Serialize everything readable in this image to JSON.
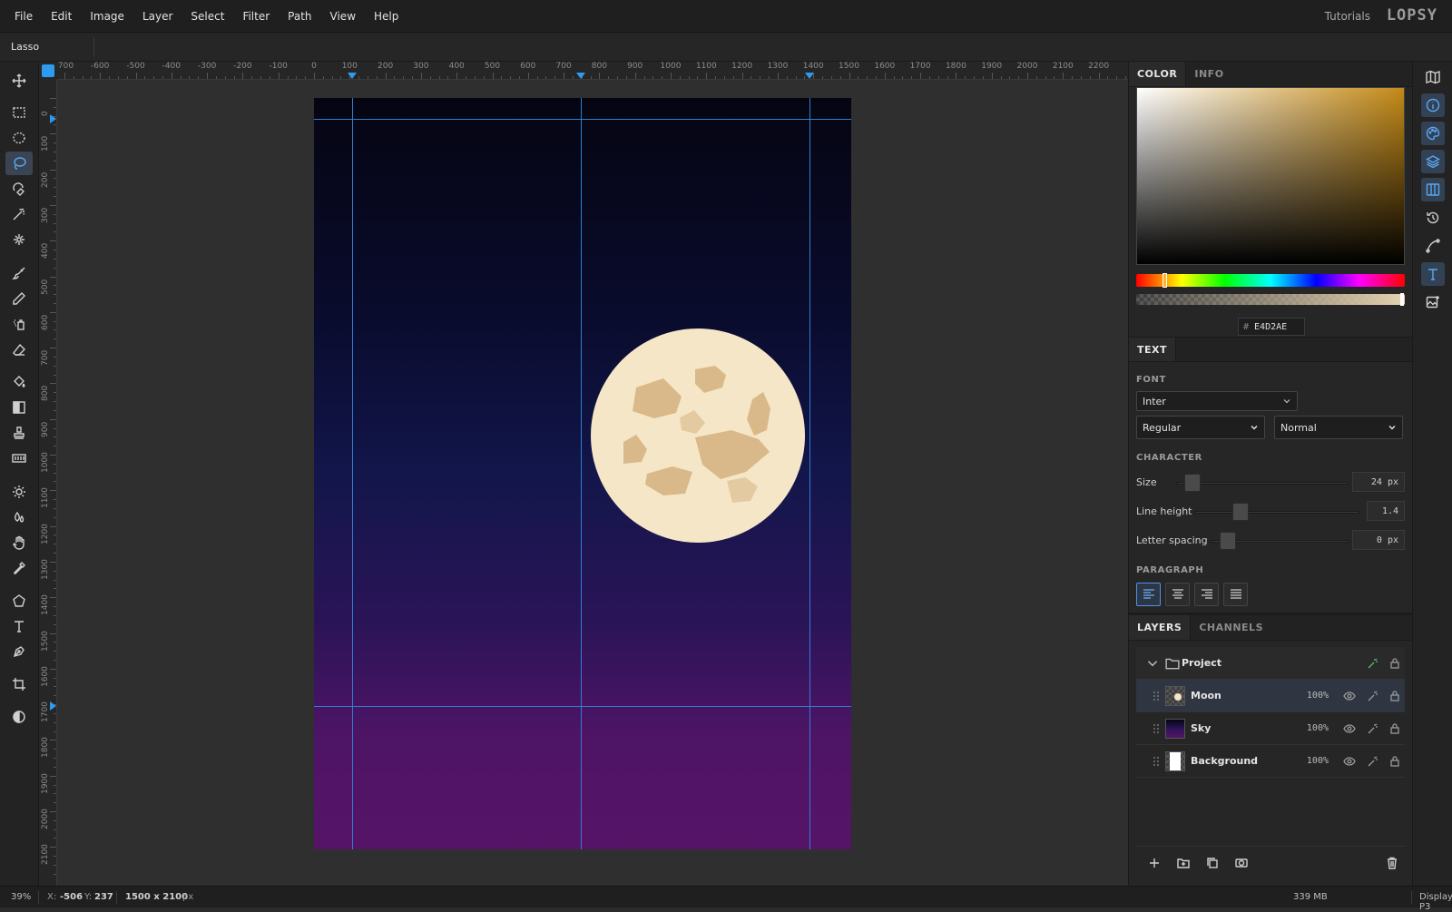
{
  "menu": [
    "File",
    "Edit",
    "Image",
    "Layer",
    "Select",
    "Filter",
    "Path",
    "View",
    "Help"
  ],
  "header": {
    "tutorials": "Tutorials",
    "logo": "LOPSY"
  },
  "options_bar": {
    "tool_name": "Lasso"
  },
  "toolbar": {
    "tools": [
      {
        "icon": "move-icon",
        "active": false
      },
      {
        "icon": "rect-select-icon",
        "active": false
      },
      {
        "icon": "ellipse-select-icon",
        "active": false
      },
      {
        "icon": "lasso-icon",
        "active": true
      },
      {
        "icon": "magnetic-lasso-icon",
        "active": false
      },
      {
        "icon": "magic-wand-icon",
        "active": false
      },
      {
        "icon": "quick-select-icon",
        "active": false
      },
      {
        "icon": "brush-icon",
        "active": false
      },
      {
        "icon": "pencil-icon",
        "active": false
      },
      {
        "icon": "spray-icon",
        "active": false
      },
      {
        "icon": "eraser-icon",
        "active": false
      },
      {
        "icon": "paint-bucket-icon",
        "active": false
      },
      {
        "icon": "gradient-icon",
        "active": false
      },
      {
        "icon": "stamp-icon",
        "active": false
      },
      {
        "icon": "pattern-icon",
        "active": false
      },
      {
        "icon": "dodge-icon",
        "active": false
      },
      {
        "icon": "blur-icon",
        "active": false
      },
      {
        "icon": "hand-icon",
        "active": false
      },
      {
        "icon": "eyedropper-icon",
        "active": false
      },
      {
        "icon": "polygon-icon",
        "active": false
      },
      {
        "icon": "text-icon",
        "active": false
      },
      {
        "icon": "pen-icon",
        "active": false
      },
      {
        "icon": "crop-icon",
        "active": false
      },
      {
        "icon": "contrast-icon",
        "active": false
      }
    ]
  },
  "rulers": {
    "top": [
      "-700",
      "-600",
      "-500",
      "-400",
      "-300",
      "-200",
      "-100",
      "0",
      "100",
      "200",
      "300",
      "400",
      "500",
      "600",
      "700",
      "800",
      "900",
      "1000",
      "1100",
      "1200",
      "1300",
      "1400",
      "1500",
      "1600",
      "1700",
      "1800",
      "1900",
      "2000",
      "2100",
      "2200"
    ],
    "left": [
      "0",
      "100",
      "200",
      "300",
      "400",
      "500",
      "600",
      "700",
      "800",
      "900",
      "1000",
      "1100",
      "1200",
      "1300",
      "1400",
      "1500",
      "1600",
      "1700",
      "1800",
      "1900",
      "2000",
      "2100"
    ]
  },
  "canvas": {
    "gradient_top": "#050512",
    "gradient_bottom": "#561467",
    "moon_color": "#f5e6c7",
    "crater_color": "#d9b98a"
  },
  "color_panel": {
    "tabs": [
      "COLOR",
      "INFO"
    ],
    "hex_prefix": "#",
    "hex_value": "E4D2AE",
    "hue_base": "#c48a17"
  },
  "text_panel": {
    "tab": "TEXT",
    "font_label": "FONT",
    "font_value": "Inter",
    "weight_value": "Regular",
    "style_value": "Normal",
    "character_label": "CHARACTER",
    "size_label": "Size",
    "size_value": "24 px",
    "line_height_label": "Line height",
    "line_height_value": "1.4",
    "letter_spacing_label": "Letter spacing",
    "letter_spacing_value": "0 px",
    "paragraph_label": "PARAGRAPH"
  },
  "layers_panel": {
    "tabs": [
      "LAYERS",
      "CHANNELS"
    ],
    "group_name": "Project",
    "layers": [
      {
        "name": "Moon",
        "opacity": "100%",
        "selected": true
      },
      {
        "name": "Sky",
        "opacity": "100%",
        "selected": false
      },
      {
        "name": "Background",
        "opacity": "100%",
        "selected": false
      }
    ]
  },
  "status": {
    "zoom": "39%",
    "x_label": "X:",
    "x_value": "-506",
    "y_label": "Y:",
    "y_value": "237",
    "doc_size": "1500 x 2100",
    "doc_unit": "px",
    "memory": "339 MB",
    "color_profile": "Display P3"
  },
  "accent_color": "#2d9bf0"
}
